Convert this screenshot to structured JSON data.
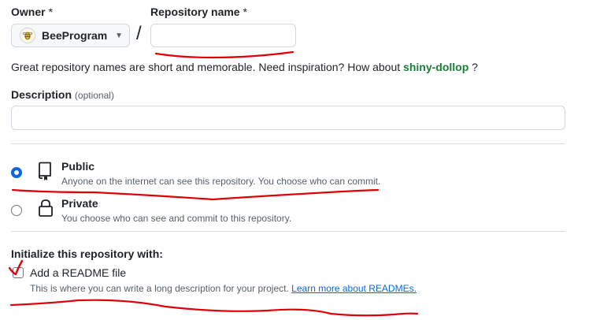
{
  "owner": {
    "label": "Owner",
    "required_mark": "*",
    "value": "BeeProgram",
    "avatar_icon": "bee-avatar-icon"
  },
  "repo_name": {
    "label": "Repository name",
    "required_mark": "*",
    "value": "",
    "placeholder": ""
  },
  "separator": "/",
  "hint": {
    "text": "Great repository names are short and memorable. Need inspiration? How about",
    "suggestion": "shiny-dollop",
    "suffix": "?"
  },
  "description": {
    "label": "Description",
    "optional": "(optional)",
    "value": ""
  },
  "visibility": [
    {
      "title": "Public",
      "desc": "Anyone on the internet can see this repository. You choose who can commit.",
      "icon": "repo-icon",
      "selected": true
    },
    {
      "title": "Private",
      "desc": "You choose who can see and commit to this repository.",
      "icon": "lock-icon",
      "selected": false
    }
  ],
  "init": {
    "heading": "Initialize this repository with:",
    "readme": {
      "label": "Add a README file",
      "desc": "This is where you can write a long description for your project.",
      "link": "Learn more about READMEs.",
      "checked": false
    }
  },
  "colors": {
    "accent": "#0969da",
    "suggestion": "#1a7f37",
    "annotation": "#e0000a"
  }
}
